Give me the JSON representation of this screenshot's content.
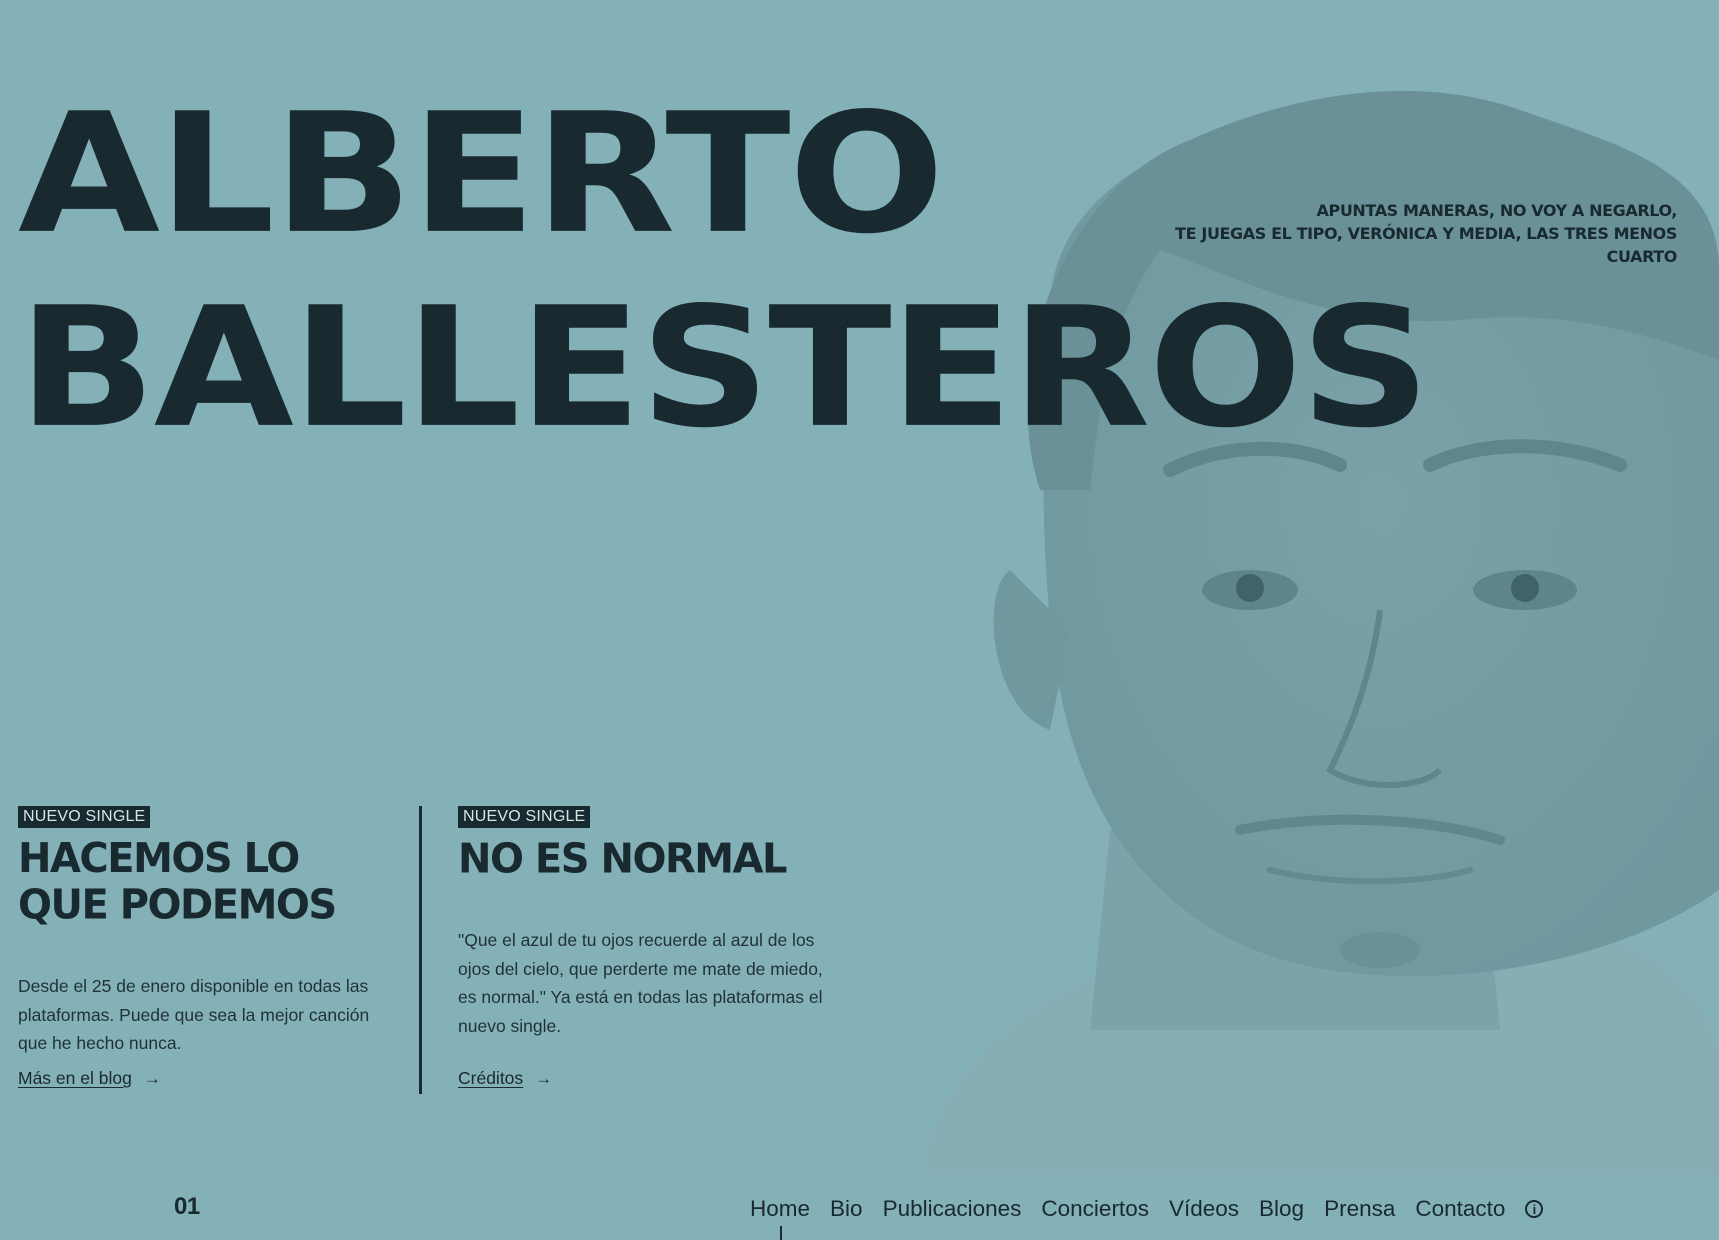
{
  "hero": {
    "title_line1": "ALBERTO",
    "title_line2": "BALLESTEROS",
    "tagline": [
      "APUNTAS MANERAS, NO VOY A NEGARLO,",
      "TE JUEGAS EL TIPO, VERÓNICA Y MEDIA, LAS TRES MENOS CUARTO"
    ]
  },
  "cards": [
    {
      "badge": "NUEVO SINGLE",
      "title_line1": "HACEMOS LO",
      "title_line2": "QUE PODEMOS",
      "text": "Desde el 25 de enero disponible en todas las plataformas. Puede que sea la mejor canción que he hecho nunca.",
      "link": "Más en el blog",
      "arrow": "→"
    },
    {
      "badge": "NUEVO SINGLE",
      "title_line1": "NO ES NORMAL",
      "text": "\"Que el azul de tu ojos recuerde al azul de los ojos del cielo, que perderte me mate de miedo, es normal.\" Ya está en todas las plataformas el nuevo single.",
      "link": "Créditos",
      "arrow": "→"
    }
  ],
  "pager": "01",
  "nav": {
    "items": [
      "Home",
      "Bio",
      "Publicaciones",
      "Conciertos",
      "Vídeos",
      "Blog",
      "Prensa",
      "Contacto"
    ],
    "info_icon": "info-icon",
    "info_glyph": "i",
    "active": "Home"
  },
  "colors": {
    "background": "#84b0b7",
    "ink": "#182a2f",
    "badge_text": "#d6e6e8"
  }
}
